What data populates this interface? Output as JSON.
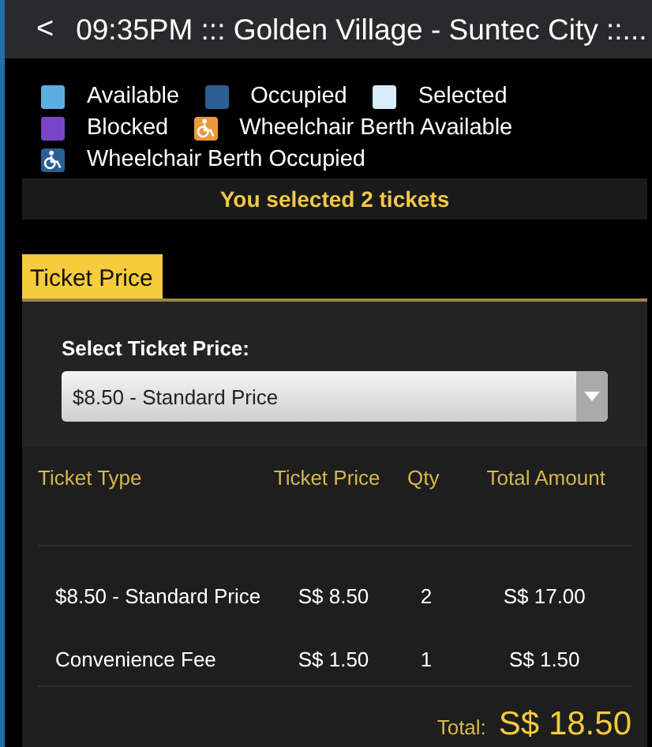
{
  "header": {
    "back": "<",
    "title": "09:35PM ::: Golden Village - Suntec City ::..."
  },
  "legend": [
    {
      "label": "Available",
      "kind": "seat",
      "color": "#5aaee2"
    },
    {
      "label": "Occupied",
      "kind": "seat",
      "color": "#2b5f92"
    },
    {
      "label": "Selected",
      "kind": "seat",
      "color": "#d8ecf9"
    },
    {
      "label": "Blocked",
      "kind": "seat",
      "color": "#7b44c8"
    },
    {
      "label": "Wheelchair Berth Available",
      "kind": "wheelchair",
      "color": "#e89a3c"
    },
    {
      "label": "Wheelchair Berth Occupied",
      "kind": "wheelchair",
      "color": "#2b5f92"
    }
  ],
  "selection_notice": "You selected 2 tickets",
  "tabs": [
    {
      "label": "Ticket Price",
      "selected": true
    }
  ],
  "price_select": {
    "label": "Select Ticket Price:",
    "value": "$8.50 - Standard Price"
  },
  "table": {
    "columns": [
      "Ticket Type",
      "Ticket Price",
      "Qty",
      "Total Amount"
    ],
    "rows": [
      [
        "$8.50 - Standard Price",
        "S$ 8.50",
        "2",
        "S$ 17.00"
      ],
      [
        "Convenience Fee",
        "S$ 1.50",
        "1",
        "S$ 1.50"
      ]
    ]
  },
  "total": {
    "label": "Total:",
    "amount": "S$ 18.50"
  }
}
